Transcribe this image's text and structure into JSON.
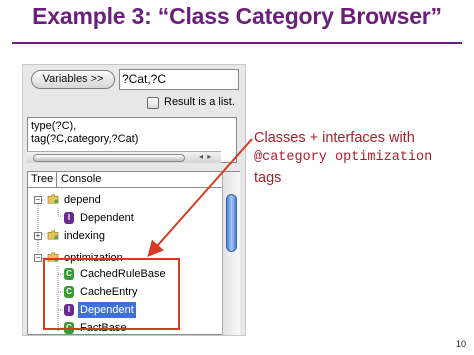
{
  "slide": {
    "title": "Example 3: “Class Category Browser”",
    "page_number": "10"
  },
  "browser": {
    "variables_button_label": "Variables >>",
    "variables_value": "?Cat,?C",
    "result_list_label": "Result is a list.",
    "result_list_checked": false,
    "query_lines": [
      "type(?C),",
      "tag(?C,category,?Cat)"
    ],
    "tabs": [
      "Tree",
      "Console"
    ],
    "active_tab": "Tree",
    "tree": [
      {
        "label": "depend",
        "kind": "category",
        "expander": "−",
        "icon": "folder-icon"
      },
      {
        "label": "Dependent",
        "kind": "interface",
        "icon": "I"
      },
      {
        "label": "indexing",
        "kind": "category",
        "expander": "+",
        "icon": "folder-icon"
      },
      {
        "label": "optimization",
        "kind": "category",
        "expander": "−",
        "icon": "folder-icon"
      },
      {
        "label": "CachedRuleBase",
        "kind": "class",
        "icon": "C"
      },
      {
        "label": "CacheEntry",
        "kind": "class",
        "icon": "C"
      },
      {
        "label": "Dependent",
        "kind": "interface",
        "icon": "I",
        "selected": true
      },
      {
        "label": "FactBase",
        "kind": "class",
        "icon": "C"
      }
    ]
  },
  "annotation": {
    "line1": "Classes + interfaces with",
    "line2": "@category optimization",
    "line3": "tags"
  },
  "colors": {
    "title": "#6a1f7a",
    "annotation": "#a8202a",
    "highlight_box": "#d8391f",
    "class_icon": "#3a9a34",
    "interface_icon": "#6a2a8c",
    "selection": "#3f70d6"
  }
}
